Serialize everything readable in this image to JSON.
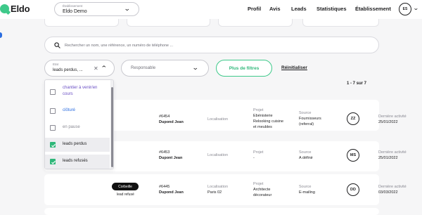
{
  "brand": {
    "name": "Eldo"
  },
  "establishment": {
    "label": "Établissement",
    "value": "Eldo Demo"
  },
  "nav": {
    "profil": "Profil",
    "avis": "Avis",
    "leads": "Leads",
    "statistiques": "Statistiques",
    "etablissement": "Établissement"
  },
  "user": {
    "initials": "ES"
  },
  "search": {
    "placeholder": "Rechercher un nom, une référence, un numéro de téléphone ..."
  },
  "filters": {
    "etat_label": "Etat",
    "etat_value": "leads perdus, ...",
    "responsable": "Responsable",
    "more": "Plus de filtres",
    "reset": "Réinitialiser"
  },
  "pagination": {
    "count": "1 - 7 sur 7"
  },
  "dropdown_options": [
    {
      "label": "chantier à venir/en cours",
      "checked": false,
      "color": "#6a4fc4"
    },
    {
      "label": "clôturé",
      "checked": false,
      "color": "#2b6de0"
    },
    {
      "label": "en pause",
      "checked": false,
      "color": "#8a8a93"
    },
    {
      "label": "leads perdus",
      "checked": true,
      "color": "#1d1d1f"
    },
    {
      "label": "leads refusés",
      "checked": true,
      "color": "#1d1d1f"
    }
  ],
  "rows": [
    {
      "ref": "#6454",
      "name": "Dupond Jean",
      "loc_title": "Localisation",
      "loc_value": "",
      "proj_title": "Projet",
      "proj_lines": [
        "Ebénisterie",
        "Relooking cuisine",
        "et meubles"
      ],
      "src_title": "Source",
      "src_lines": [
        "Fournisseurs",
        "(referral)"
      ],
      "initials": "ZZ",
      "act_title": "Dernière activité",
      "act_value": "25/01/2022"
    },
    {
      "ref": "#6453",
      "name": "Dupont Jean",
      "loc_title": "Localisation",
      "loc_value": "",
      "proj_title": "Projet",
      "proj_lines": [
        "-"
      ],
      "src_title": "Source",
      "src_lines": [
        "A définir"
      ],
      "initials": "MS",
      "act_title": "Dernière activité",
      "act_value": "25/01/2022"
    },
    {
      "ref": "#6445",
      "name": "Dupond Jean",
      "loc_title": "Localisation",
      "loc_value": "Paris 02",
      "proj_title": "Projet",
      "proj_lines": [
        "Architecte",
        "décorateur"
      ],
      "src_title": "Source",
      "src_lines": [
        "E-mailing"
      ],
      "initials": "DD",
      "act_title": "Dernière activité",
      "act_value": "03/03/2022",
      "bin_label": "Corbeille",
      "status": "lead refusé"
    }
  ]
}
